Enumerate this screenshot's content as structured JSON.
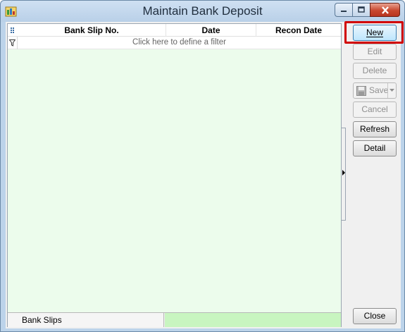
{
  "window": {
    "title": "Maintain Bank Deposit",
    "icon": "app-icon"
  },
  "grid": {
    "columns": [
      "Bank Slip No.",
      "Date",
      "Recon Date"
    ],
    "filter_prompt": "Click here to define a filter",
    "rows": [],
    "footer_tab": "Bank Slips"
  },
  "buttons": {
    "new": {
      "label": "New",
      "accesskey": "N",
      "enabled": true,
      "highlighted": true
    },
    "edit": {
      "label": "Edit",
      "accesskey": "E",
      "enabled": false
    },
    "delete": {
      "label": "Delete",
      "accesskey": "D",
      "enabled": false
    },
    "save": {
      "label": "Save",
      "accesskey": "S",
      "enabled": false
    },
    "cancel": {
      "label": "Cancel",
      "accesskey": "C",
      "enabled": false
    },
    "refresh": {
      "label": "Refresh",
      "enabled": true
    },
    "detail": {
      "label": "Detail",
      "accesskey": "t",
      "enabled": true
    },
    "close": {
      "label": "Close",
      "enabled": true
    }
  },
  "colors": {
    "grid_background": "#ecfcec",
    "footer_green": "#c8f5c0",
    "highlight": "#d10000",
    "titlebar": "#c4d8ee"
  }
}
